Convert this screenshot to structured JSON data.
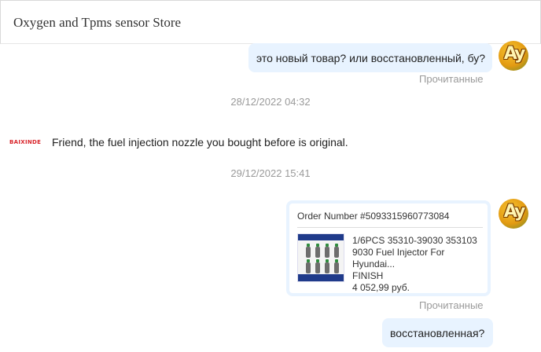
{
  "header": {
    "title": "Oxygen and Tpms sensor Store"
  },
  "messages": [
    {
      "side": "out",
      "text": "это новый товар? или восстановленный, бу?",
      "status": "Прочитанные"
    },
    {
      "side": "system",
      "timestamp": "28/12/2022 04:32"
    },
    {
      "side": "in",
      "sender_logo": "BAIXINDE",
      "text": "Friend, the fuel injection nozzle you bought before is original."
    },
    {
      "side": "system",
      "timestamp": "29/12/2022 15:41"
    },
    {
      "side": "out",
      "order": {
        "number_label": "Order Number #5093315960773084",
        "product_title": "1/6PCS 35310-39030 353103 9030 Fuel Injector For Hyundai...",
        "status": "FINISH",
        "price": "4 052,99 руб."
      },
      "status": "Прочитанные"
    },
    {
      "side": "out",
      "text": "восстановленная?"
    }
  ],
  "avatar": {
    "text": "Ay",
    "icon": "user-avatar"
  },
  "colors": {
    "outgoing_bubble": "#e8f3ff",
    "muted_text": "#9a9a9a",
    "logo_red": "#d9252b"
  }
}
